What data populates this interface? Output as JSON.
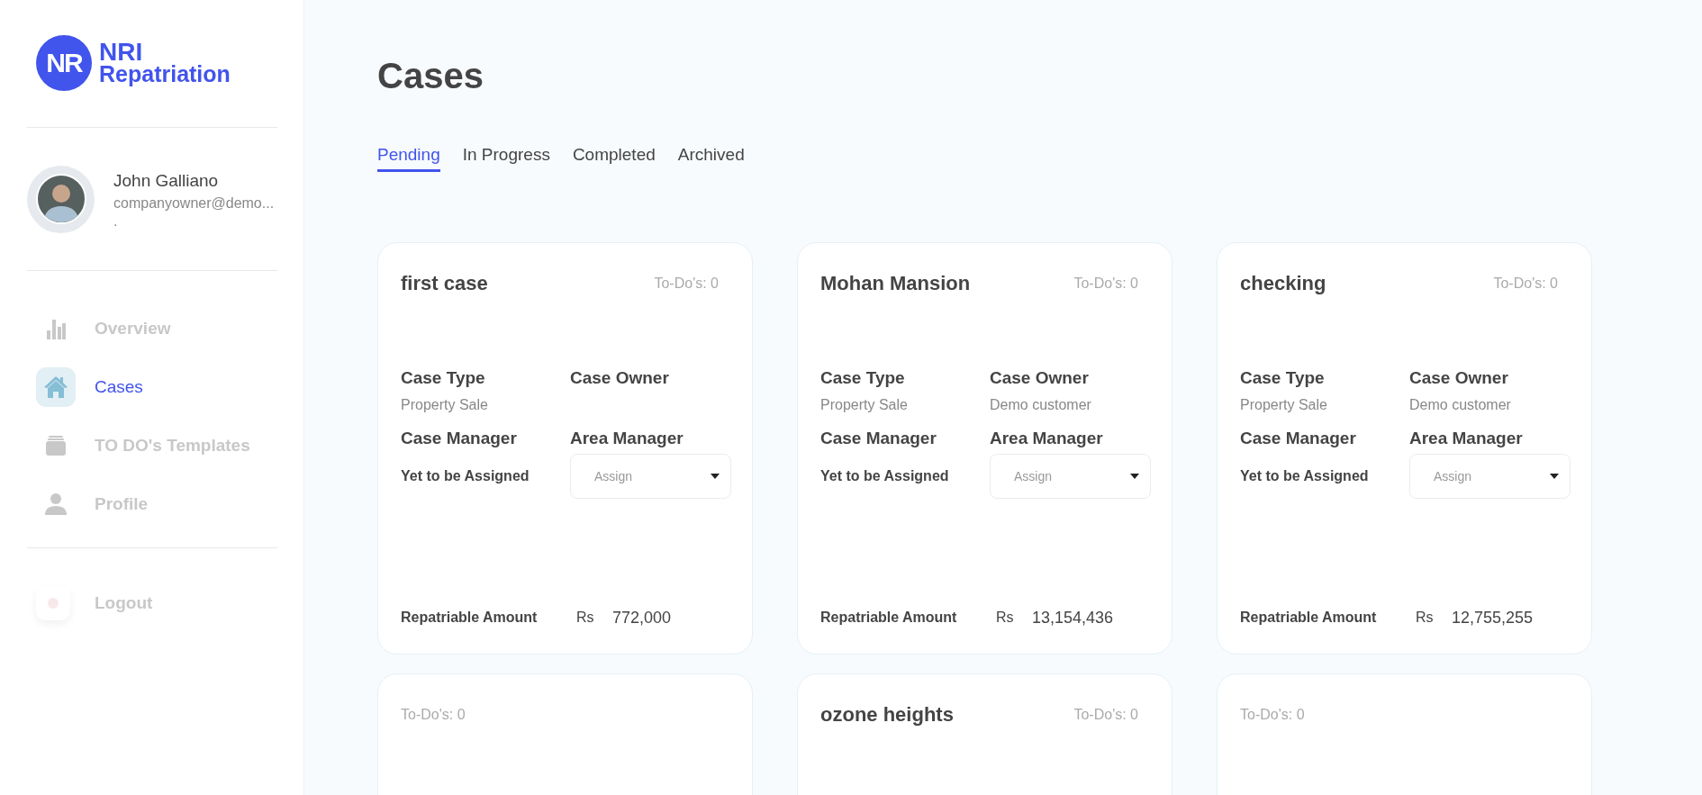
{
  "logo": {
    "mark": "NR",
    "line1": "NRI",
    "line2": "Repatriation"
  },
  "user": {
    "name": "John Galliano",
    "email": "companyowner@demo...",
    "extra": "."
  },
  "nav": [
    {
      "label": "Overview",
      "selected": false
    },
    {
      "label": "Cases",
      "selected": true
    },
    {
      "label": "TO DO's Templates",
      "selected": false
    },
    {
      "label": "Profile",
      "selected": false
    }
  ],
  "logout": {
    "label": "Logout"
  },
  "page": {
    "title": "Cases"
  },
  "tabs": [
    {
      "label": "Pending",
      "selected": true
    },
    {
      "label": "In Progress",
      "selected": false
    },
    {
      "label": "Completed",
      "selected": false
    },
    {
      "label": "Archived",
      "selected": false
    }
  ],
  "cases": [
    {
      "title": "first case",
      "todos": "To-Do's: 0",
      "details": {
        "type_label": "Case Type",
        "type": "Property Sale",
        "owner_label": "Case Owner",
        "manager_label": "Case Manager",
        "manager": "Yet to be Assigned",
        "area_label": "Area Manager",
        "area_placeholder": "Assign",
        "amount_label": "Repatriable Amount",
        "currency": "Rs",
        "amount": "772,000"
      }
    },
    {
      "title": "Mohan Mansion",
      "todos": "To-Do's: 0",
      "details": {
        "type_label": "Case Type",
        "type": "Property Sale",
        "owner_label": "Case Owner",
        "owner": "Demo customer",
        "manager_label": "Case Manager",
        "manager": "Yet to be Assigned",
        "area_label": "Area Manager",
        "area_placeholder": "Assign",
        "amount_label": "Repatriable Amount",
        "currency": "Rs",
        "amount": "13,154,436"
      }
    },
    {
      "title": "checking",
      "todos": "To-Do's: 0",
      "details": {
        "type_label": "Case Type",
        "type": "Property Sale",
        "owner_label": "Case Owner",
        "owner": "Demo customer",
        "manager_label": "Case Manager",
        "manager": "Yet to be Assigned",
        "area_label": "Area Manager",
        "area_placeholder": "Assign",
        "amount_label": "Repatriable Amount",
        "currency": "Rs",
        "amount": "12,755,255"
      }
    },
    {
      "todos": "To-Do's: 0"
    },
    {
      "title": "ozone heights",
      "todos": "To-Do's: 0"
    },
    {
      "todos": "To-Do's: 0"
    }
  ]
}
